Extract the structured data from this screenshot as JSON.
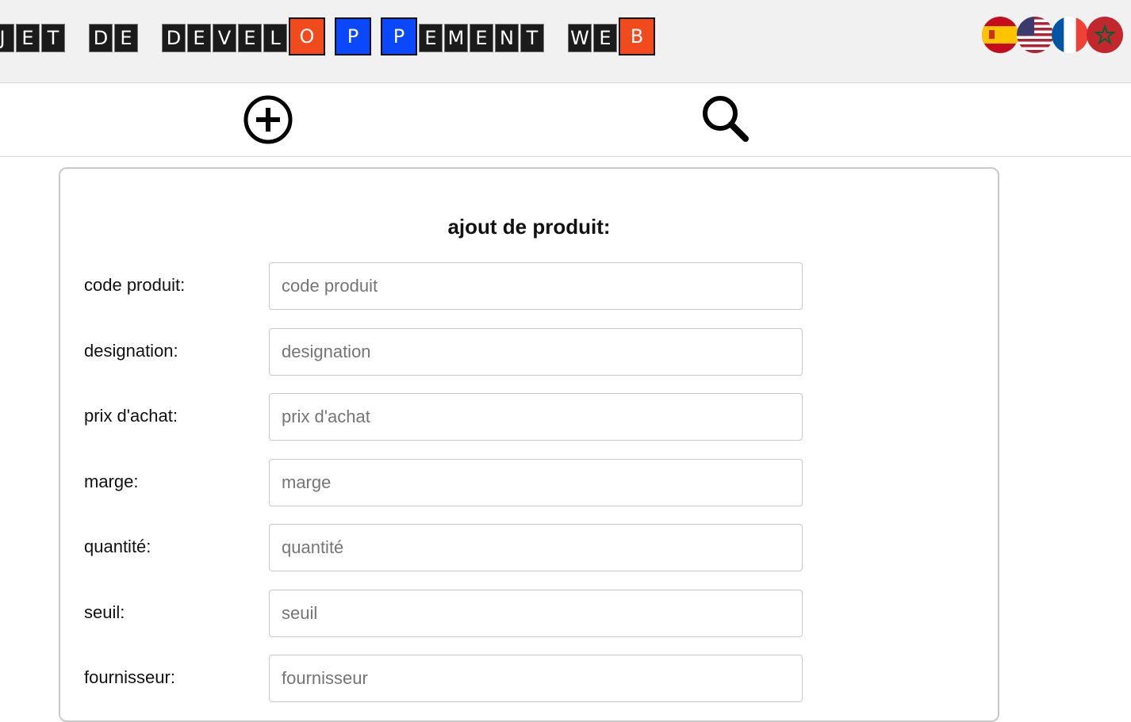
{
  "header": {
    "title_words": [
      [
        "J",
        "E",
        "T"
      ],
      [
        "D",
        "E"
      ],
      [
        "D",
        "E",
        "V",
        "E",
        "L",
        "O",
        "P",
        "P",
        "E",
        "M",
        "E",
        "N",
        "T"
      ],
      [
        "W",
        "E",
        "B"
      ]
    ],
    "flags": [
      "spain-flag",
      "usa-flag",
      "france-flag",
      "morocco-flag"
    ],
    "colors": {
      "tile_red": "#f04a1d",
      "tile_blue": "#0a47ff",
      "tile_dark": "#1b1b1b"
    }
  },
  "toolbar": {
    "add_icon": "plus-circle-icon",
    "search_icon": "search-icon"
  },
  "form": {
    "title": "ajout de produit:",
    "fields": [
      {
        "label": "code produit:",
        "placeholder": "code produit"
      },
      {
        "label": "designation:",
        "placeholder": "designation"
      },
      {
        "label": "prix d'achat:",
        "placeholder": "prix d'achat"
      },
      {
        "label": "marge:",
        "placeholder": "marge"
      },
      {
        "label": "quantité:",
        "placeholder": "quantité"
      },
      {
        "label": "seuil:",
        "placeholder": "seuil"
      },
      {
        "label": "fournisseur:",
        "placeholder": "fournisseur"
      }
    ]
  }
}
